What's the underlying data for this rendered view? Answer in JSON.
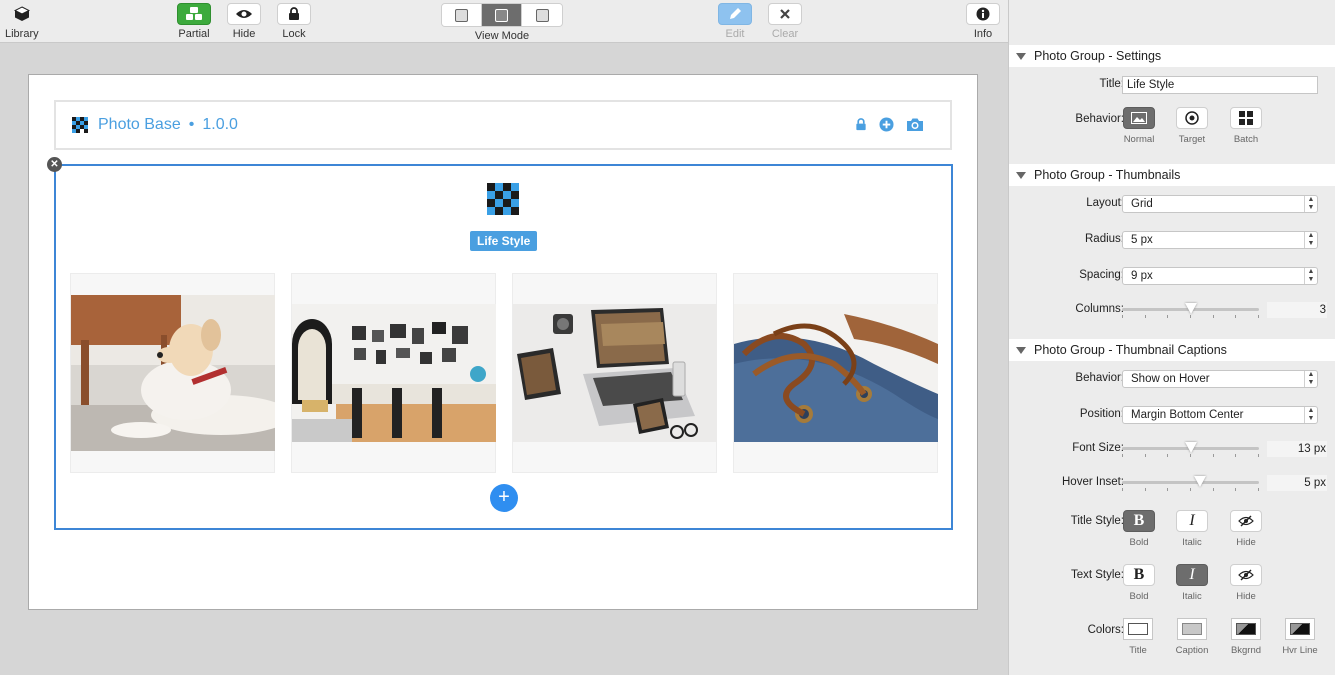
{
  "toolbar": {
    "library": "Library",
    "partial": "Partial",
    "hide": "Hide",
    "lock": "Lock",
    "view_mode": "View Mode",
    "edit": "Edit",
    "clear": "Clear",
    "info": "Info"
  },
  "header": {
    "title": "Photo Base",
    "separator": "•",
    "version": "1.0.0"
  },
  "group": {
    "title_badge": "Life Style",
    "thumbnails": [
      {
        "subject": "dog on floor"
      },
      {
        "subject": "kitchen with frames"
      },
      {
        "subject": "laptop on desk"
      },
      {
        "subject": "shoe laces"
      }
    ]
  },
  "inspector": {
    "settings": {
      "header": "Photo Group - Settings",
      "title_label": "Title:",
      "title_value": "Life Style",
      "behavior_label": "Behavior:",
      "behavior_options": [
        "Normal",
        "Target",
        "Batch"
      ],
      "behavior_selected": "Normal"
    },
    "thumbnails": {
      "header": "Photo Group - Thumbnails",
      "layout_label": "Layout:",
      "layout_value": "Grid",
      "radius_label": "Radius:",
      "radius_value": "5 px",
      "spacing_label": "Spacing:",
      "spacing_value": "9 px",
      "columns_label": "Columns:",
      "columns_value": "3",
      "columns_slider_fraction": 0.5
    },
    "captions": {
      "header": "Photo Group - Thumbnail Captions",
      "behavior_label": "Behavior:",
      "behavior_value": "Show on Hover",
      "position_label": "Position:",
      "position_value": "Margin Bottom Center",
      "font_size_label": "Font Size:",
      "font_size_value": "13 px",
      "font_size_fraction": 0.5,
      "hover_inset_label": "Hover Inset:",
      "hover_inset_value": "5 px",
      "hover_inset_fraction": 0.57,
      "title_style_label": "Title Style:",
      "text_style_label": "Text Style:",
      "style_options": [
        "Bold",
        "Italic",
        "Hide"
      ],
      "title_style_selected": "Bold",
      "text_style_selected": "Italic",
      "colors_label": "Colors:",
      "color_options": [
        "Title",
        "Caption",
        "Bkgrnd",
        "Hvr Line"
      ]
    }
  },
  "colors": {
    "accent": "#4a9fe0",
    "selection": "#3d86d6",
    "add_button": "#2f8ef0",
    "partial_green": "#3daa3d"
  }
}
